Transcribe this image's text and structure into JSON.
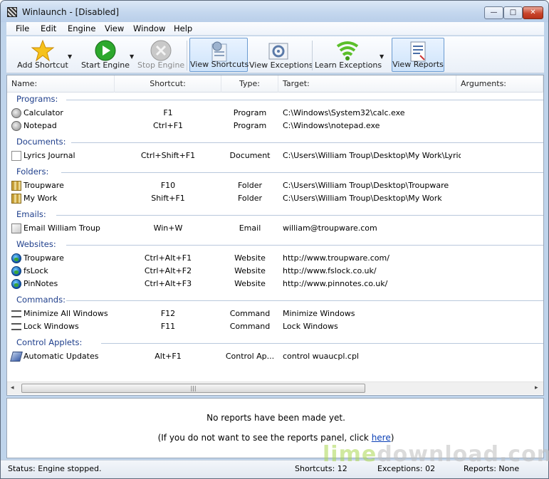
{
  "window": {
    "title": "Winlaunch - [Disabled]"
  },
  "menu": [
    "File",
    "Edit",
    "Engine",
    "View",
    "Window",
    "Help"
  ],
  "toolbar": {
    "add_shortcut": "Add Shortcut",
    "start_engine": "Start Engine",
    "stop_engine": "Stop Engine",
    "view_shortcuts": "View Shortcuts",
    "view_exceptions": "View Exceptions",
    "learn_exceptions": "Learn Exceptions",
    "view_reports": "View Reports"
  },
  "columns": {
    "name": "Name:",
    "shortcut": "Shortcut:",
    "type": "Type:",
    "target": "Target:",
    "arguments": "Arguments:"
  },
  "groups": [
    {
      "label": "Programs:",
      "items": [
        {
          "name": "Calculator",
          "shortcut": "F1",
          "type": "Program",
          "target": "C:\\Windows\\System32\\calc.exe",
          "icon": "program-icon"
        },
        {
          "name": "Notepad",
          "shortcut": "Ctrl+F1",
          "type": "Program",
          "target": "C:\\Windows\\notepad.exe",
          "icon": "program-icon"
        }
      ]
    },
    {
      "label": "Documents:",
      "items": [
        {
          "name": "Lyrics Journal",
          "shortcut": "Ctrl+Shift+F1",
          "type": "Document",
          "target": "C:\\Users\\William Troup\\Desktop\\My Work\\Lyric...",
          "icon": "document-icon"
        }
      ]
    },
    {
      "label": "Folders:",
      "items": [
        {
          "name": "Troupware",
          "shortcut": "F10",
          "type": "Folder",
          "target": "C:\\Users\\William Troup\\Desktop\\Troupware",
          "icon": "folder-icon"
        },
        {
          "name": "My Work",
          "shortcut": "Shift+F1",
          "type": "Folder",
          "target": "C:\\Users\\William Troup\\Desktop\\My Work",
          "icon": "folder-icon"
        }
      ]
    },
    {
      "label": "Emails:",
      "items": [
        {
          "name": "Email William Troup",
          "shortcut": "Win+W",
          "type": "Email",
          "target": "william@troupware.com",
          "icon": "email-icon"
        }
      ]
    },
    {
      "label": "Websites:",
      "items": [
        {
          "name": "Troupware",
          "shortcut": "Ctrl+Alt+F1",
          "type": "Website",
          "target": "http://www.troupware.com/",
          "icon": "globe-icon"
        },
        {
          "name": "fsLock",
          "shortcut": "Ctrl+Alt+F2",
          "type": "Website",
          "target": "http://www.fslock.co.uk/",
          "icon": "globe-icon"
        },
        {
          "name": "PinNotes",
          "shortcut": "Ctrl+Alt+F3",
          "type": "Website",
          "target": "http://www.pinnotes.co.uk/",
          "icon": "globe-icon"
        }
      ]
    },
    {
      "label": "Commands:",
      "items": [
        {
          "name": "Minimize All Windows",
          "shortcut": "F12",
          "type": "Command",
          "target": "Minimize Windows",
          "icon": "command-icon"
        },
        {
          "name": "Lock Windows",
          "shortcut": "F11",
          "type": "Command",
          "target": "Lock Windows",
          "icon": "command-icon"
        }
      ]
    },
    {
      "label": "Control Applets:",
      "items": [
        {
          "name": "Automatic Updates",
          "shortcut": "Alt+F1",
          "type": "Control Ap...",
          "target": "control wuaucpl.cpl",
          "icon": "applet-icon"
        }
      ]
    }
  ],
  "scrollbar": {
    "left": "◂",
    "right": "▸",
    "grip": "|||"
  },
  "reports": {
    "message": "No reports have been made yet.",
    "hint_prefix": "(If you do not want to see the reports panel, click ",
    "hint_link": "here",
    "hint_suffix": ")"
  },
  "status": {
    "status": "Status:  Engine stopped.",
    "shortcuts": "Shortcuts:  12",
    "exceptions": "Exceptions:  02",
    "reports": "Reports:  None"
  },
  "watermark": {
    "part1": "lime",
    "part2": "download.com"
  },
  "colors": {
    "group_header": "#1f3f8c",
    "link": "#0a3fb5",
    "active_button": "#cde3fb"
  }
}
